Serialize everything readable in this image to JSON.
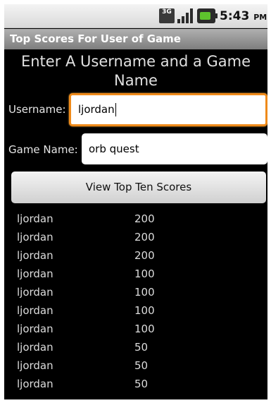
{
  "status_bar": {
    "network_badge": "3G",
    "time": "5:43",
    "time_suffix": "PM",
    "battery_color": "#5ec22d"
  },
  "app": {
    "title": "Top Scores For User of Game",
    "heading": "Enter A Username and a Game Name"
  },
  "form": {
    "username_label": "Username:",
    "username_value": "ljordan",
    "game_label": "Game Name:",
    "game_value": "orb quest",
    "submit_label": "View Top Ten Scores"
  },
  "scores": [
    {
      "user": "ljordan",
      "score": "200"
    },
    {
      "user": "ljordan",
      "score": "200"
    },
    {
      "user": "ljordan",
      "score": "200"
    },
    {
      "user": "ljordan",
      "score": "100"
    },
    {
      "user": "ljordan",
      "score": "100"
    },
    {
      "user": "ljordan",
      "score": "100"
    },
    {
      "user": "ljordan",
      "score": "100"
    },
    {
      "user": "ljordan",
      "score": "50"
    },
    {
      "user": "ljordan",
      "score": "50"
    },
    {
      "user": "ljordan",
      "score": "50"
    }
  ]
}
